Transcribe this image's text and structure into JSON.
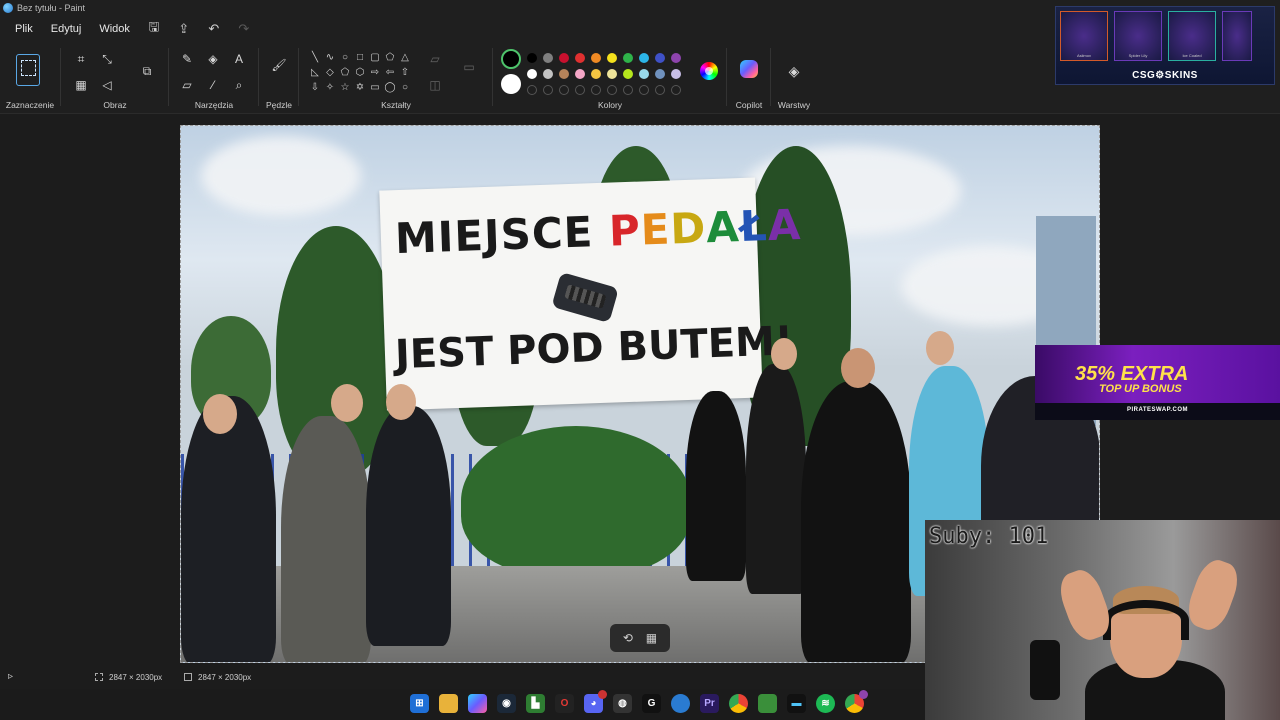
{
  "window": {
    "title": "Bez tytułu - Paint"
  },
  "menu": {
    "items": [
      "Plik",
      "Edytuj",
      "Widok"
    ]
  },
  "ribbon": {
    "groups": {
      "selection": "Zaznaczenie",
      "image": "Obraz",
      "tools": "Narzędzia",
      "brushes": "Pędzle",
      "shapes": "Kształty",
      "colors": "Kolory",
      "copilot": "Copilot",
      "layers": "Warstwy"
    },
    "primary_color": "#000000",
    "secondary_color": "#ffffff",
    "palette_row1": [
      "#000000",
      "#7f7f7f",
      "#c8102e",
      "#e03030",
      "#f08a24",
      "#f5e11c",
      "#2fb34a",
      "#2cb5e8",
      "#3f51c7",
      "#8e44ad"
    ],
    "palette_row2": [
      "#ffffff",
      "#c3c3c3",
      "#b5835a",
      "#f4a6c6",
      "#f5c542",
      "#efe49a",
      "#b5e61d",
      "#99d9ea",
      "#7092be",
      "#c8bfe7"
    ]
  },
  "banner": {
    "line1_part1": "MIEJSCE ",
    "line1_part2": [
      "P",
      "E",
      "D",
      "A",
      "Ł",
      "A"
    ],
    "line2": "JEST POD BUTEM!"
  },
  "status": {
    "selection_size": "2847 × 2030px",
    "canvas_size": "2847 × 2030px"
  },
  "overlays": {
    "csgo": {
      "brand": "CSG⚙SKINS",
      "skins": [
        "Asiimov",
        "Spider Lily",
        "Ice Coaled"
      ]
    },
    "pirateswap": {
      "headline": "35% EXTRA",
      "subline": "TOP UP BONUS",
      "url": "PIRATESWAP.COM"
    },
    "webcam": {
      "subs_label": "Suby: 101"
    }
  }
}
